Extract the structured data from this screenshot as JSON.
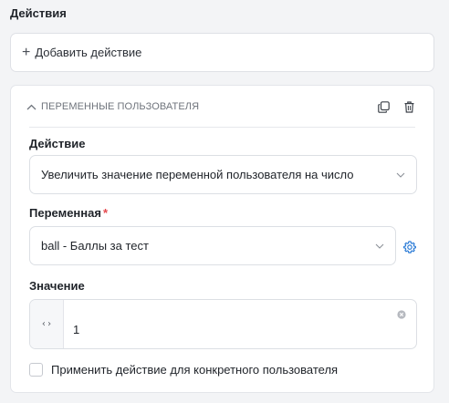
{
  "section": {
    "title": "Действия"
  },
  "add_action": {
    "plus": "+",
    "label": "Добавить действие"
  },
  "panel": {
    "title": "ПЕРЕМЕННЫЕ ПОЛЬЗОВАТЕЛЯ",
    "icons": {
      "collapse": "chevron-up-icon",
      "copy": "copy-icon",
      "delete": "trash-icon"
    }
  },
  "action_field": {
    "label": "Действие",
    "value": "Увеличить значение переменной пользователя на число"
  },
  "variable_field": {
    "label": "Переменная",
    "required_mark": "*",
    "value": "ball - Баллы за тест"
  },
  "value_field": {
    "label": "Значение",
    "code_toggle": "‹›",
    "value": "1"
  },
  "specific_user": {
    "checked": false,
    "label": "Применить действие для конкретного пользователя"
  },
  "colors": {
    "accent": "#2b7bd6",
    "required": "#e5484d",
    "border": "#dcdfe4"
  }
}
